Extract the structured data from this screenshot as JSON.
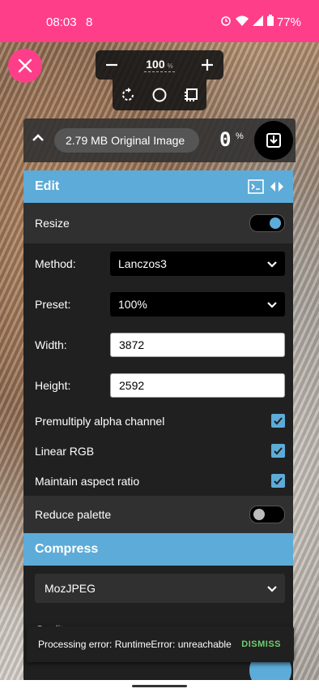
{
  "status_bar": {
    "time": "08:03",
    "notification": "8",
    "battery": "77%"
  },
  "zoom": {
    "value": "100",
    "unit": "%"
  },
  "file_info": {
    "size": "2.79 MB",
    "label": "Original Image",
    "savings_value": "0",
    "savings_unit": "%"
  },
  "edit_section": {
    "title": "Edit",
    "resize": {
      "label": "Resize",
      "enabled": true
    },
    "method": {
      "label": "Method:",
      "value": "Lanczos3"
    },
    "preset": {
      "label": "Preset:",
      "value": "100%"
    },
    "width": {
      "label": "Width:",
      "value": "3872"
    },
    "height": {
      "label": "Height:",
      "value": "2592"
    },
    "premultiply": {
      "label": "Premultiply alpha channel",
      "checked": true
    },
    "linear_rgb": {
      "label": "Linear RGB",
      "checked": true
    },
    "aspect": {
      "label": "Maintain aspect ratio",
      "checked": true
    },
    "reduce_palette": {
      "label": "Reduce palette",
      "enabled": false
    }
  },
  "compress_section": {
    "title": "Compress",
    "codec": "MozJPEG",
    "quality_label": "Quality:"
  },
  "snackbar": {
    "message": "Processing error: RuntimeError: unreachable",
    "action": "DISMISS"
  },
  "colors": {
    "accent": "#5dabd8",
    "brand": "#ff3e8a",
    "panel": "#202020"
  }
}
